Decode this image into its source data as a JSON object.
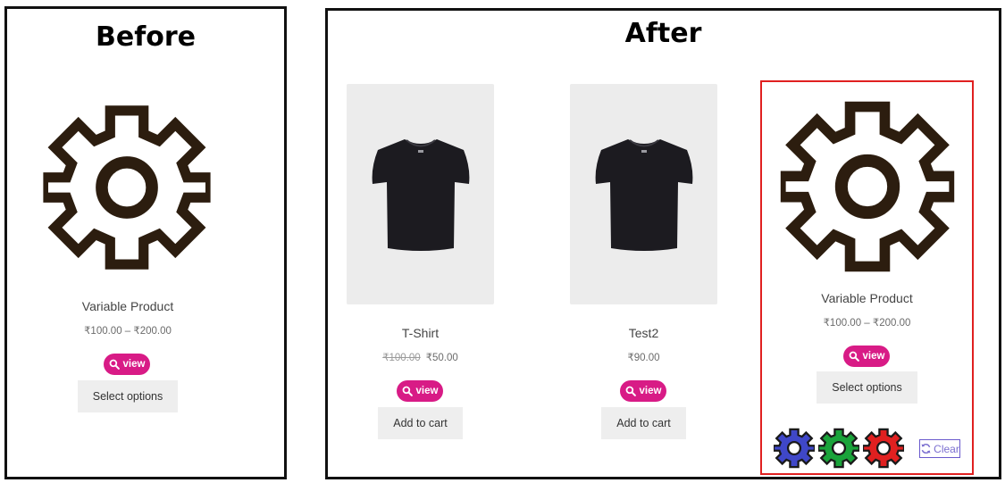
{
  "before": {
    "title": "Before",
    "product": {
      "icon": "gear-icon",
      "name": "Variable Product",
      "price": "₹100.00 – ₹200.00",
      "view_label": "view",
      "action_label": "Select options"
    }
  },
  "after": {
    "title": "After",
    "products": [
      {
        "image": "tshirt-image",
        "name": "T-Shirt",
        "old_price": "₹100.00",
        "price": "₹50.00",
        "view_label": "view",
        "action_label": "Add to cart"
      },
      {
        "image": "tshirt-image",
        "name": "Test2",
        "price": "₹90.00",
        "view_label": "view",
        "action_label": "Add to cart"
      },
      {
        "icon": "gear-icon",
        "name": "Variable Product",
        "price": "₹100.00 – ₹200.00",
        "view_label": "view",
        "action_label": "Select options",
        "swatches": [
          {
            "color_name": "blue",
            "color": "#3f47c8"
          },
          {
            "color_name": "green",
            "color": "#1aa33a"
          },
          {
            "color_name": "red",
            "color": "#e02020"
          }
        ],
        "clear_label": "Clear"
      }
    ]
  },
  "colors": {
    "accent": "#d81b86",
    "gear_dark": "#2c1d0f",
    "highlight": "#e02020",
    "clear_link": "#7b6fd0",
    "button_bg": "#eeeeee"
  }
}
